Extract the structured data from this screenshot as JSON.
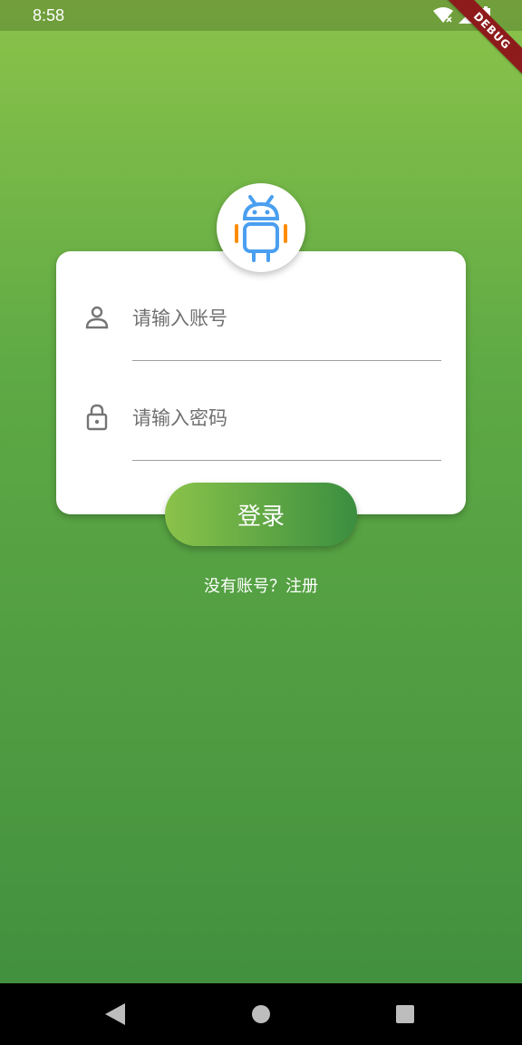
{
  "status_bar": {
    "time": "8:58",
    "icons": [
      "wifi-icon",
      "signal-icon",
      "battery-icon"
    ]
  },
  "debug_banner": "DEBUG",
  "app_logo": "android-icon",
  "login_form": {
    "username_placeholder": "请输入账号",
    "password_placeholder": "请输入密码",
    "username_icon": "person-icon",
    "password_icon": "lock-icon"
  },
  "login_button_label": "登录",
  "register_link_text": "没有账号？注册",
  "colors": {
    "gradient_top": "#8bc34a",
    "gradient_bottom": "#3f8e3e",
    "android_blue": "#4a9ff0",
    "android_orange": "#ff8c00",
    "debug_red": "#8e1b1b"
  },
  "nav_bar": {
    "buttons": [
      "back-icon",
      "home-icon",
      "recent-apps-icon"
    ]
  }
}
